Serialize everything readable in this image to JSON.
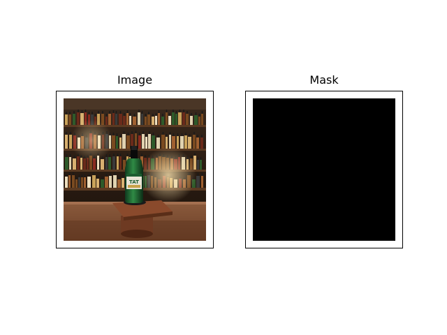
{
  "panels": [
    {
      "title": "Image"
    },
    {
      "title": "Mask"
    }
  ],
  "image_panel": {
    "subject": "bottle-on-bar-counter",
    "label_text": "TAT"
  },
  "mask_panel": {
    "fill_color": "#000000"
  }
}
